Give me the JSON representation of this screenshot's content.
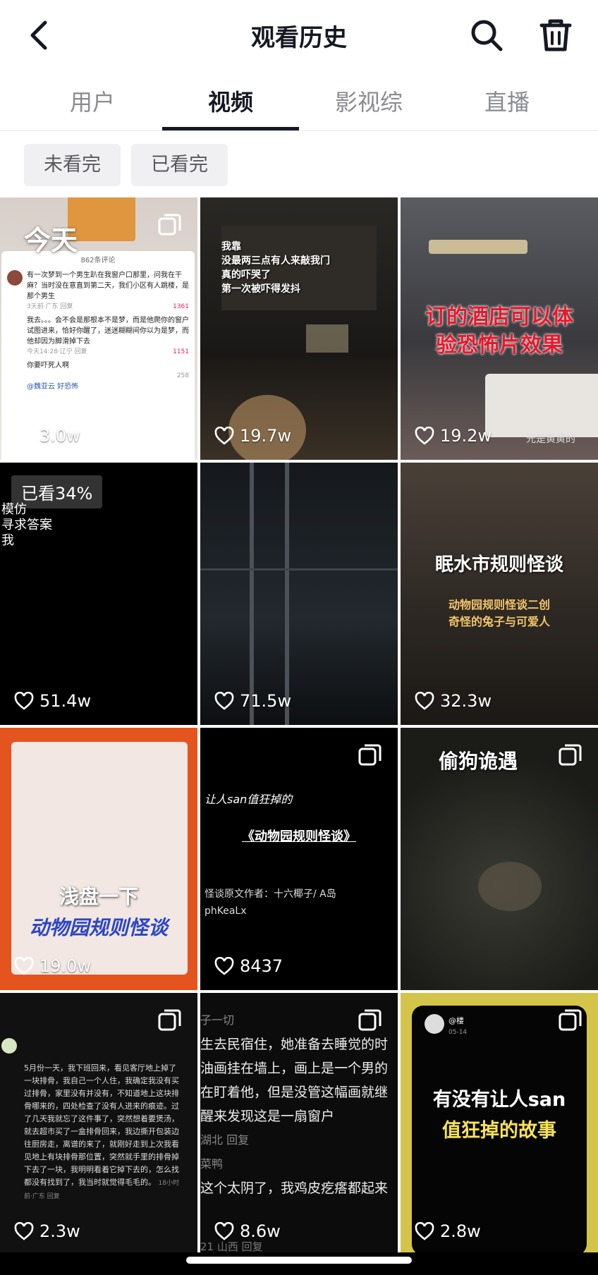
{
  "header": {
    "title": "观看历史"
  },
  "tabs": [
    {
      "label": "用户"
    },
    {
      "label": "视频"
    },
    {
      "label": "影视综"
    },
    {
      "label": "直播"
    }
  ],
  "filters": [
    {
      "label": "未看完"
    },
    {
      "label": "已看完"
    }
  ],
  "section_label": "今天",
  "tiles": [
    {
      "likes": "3.0w",
      "overlay": [
        "862条评论",
        "有一次梦到一个男生趴在我窗户口那里，问我在干麻？当时没在意直到第二天，我们小区有人跳楼，是那个男生",
        "3天前·广东  回复",
        "1361",
        "我去。。。会不会是那根本不是梦，而是他爬你的窗户试图进来，恰好你醒了，迷迷糊糊间你以为是梦，而他却因为脚滑掉下去",
        "今天14:28·辽宁  回复",
        "1151",
        "你要吓死人啊",
        "258",
        "@魏亚云 好恐怖"
      ]
    },
    {
      "likes": "19.7w",
      "overlay": [
        "我靠",
        "没最两三点有人来敲我门",
        "真的吓哭了",
        "第一次被吓得发抖"
      ]
    },
    {
      "likes": "19.2w",
      "overlay": [
        "订的酒店可以体",
        "验恐怖片效果",
        "光是黄黄的"
      ]
    },
    {
      "likes": "51.4w",
      "watched": "已看34%",
      "overlay": [
        "模仿",
        "寻求答案",
        "我"
      ]
    },
    {
      "likes": "71.5w",
      "overlay": []
    },
    {
      "likes": "32.3w",
      "overlay": [
        "眠水市规则怪谈",
        "动物园规则怪谈二创",
        "奇怪的兔子与可爱人"
      ]
    },
    {
      "likes": "19.0w",
      "overlay": [
        "浅盘一下",
        "动物园规则怪谈"
      ]
    },
    {
      "likes": "8437",
      "overlay": [
        "让人san值狂掉的",
        "《动物园规则怪谈》",
        "怪谈原文作者：十六椰子/ A岛",
        "phKeaLx"
      ]
    },
    {
      "likes": "",
      "overlay": [
        "偷狗诡遇"
      ]
    },
    {
      "likes": "2.3w",
      "overlay": [
        "5月份一天，我下班回来，看见客厅地上掉了一块排骨，我自己一个人住，我确定我没有买过排骨，家里没有并没有，不知道地上这块排骨哪来的，四处检查了没有人进来的痕迹。过了几天我就忘了这件事了，突然想着要煲汤，就去超市买了一盒排骨回来，我边撕开包装边往厨房走，离谱的来了，就刚好走到上次我看见地上有块排骨那位置，突然就手里的排骨掉下去了一块，我明明看着它掉下去的，怎么找都没有找到了，我当时就觉得毛毛的。",
        "18小时前·广东  回复"
      ]
    },
    {
      "likes": "8.6w",
      "overlay": [
        "子一切",
        "生去民宿住，她准备去睡觉的时",
        "油画挂在墙上，画上是一个男的",
        "在盯着他，但是没管这幅画就继",
        "醒来发现这是一扇窗户",
        "湖北  回复",
        "菜鸭",
        "这个太阴了，我鸡皮疙瘩都起来",
        "21 山西  回复"
      ]
    },
    {
      "likes": "2.8w",
      "overlay": [
        "@楼",
        "05-14",
        "有没有让人san",
        "值狂掉的故事"
      ]
    }
  ]
}
